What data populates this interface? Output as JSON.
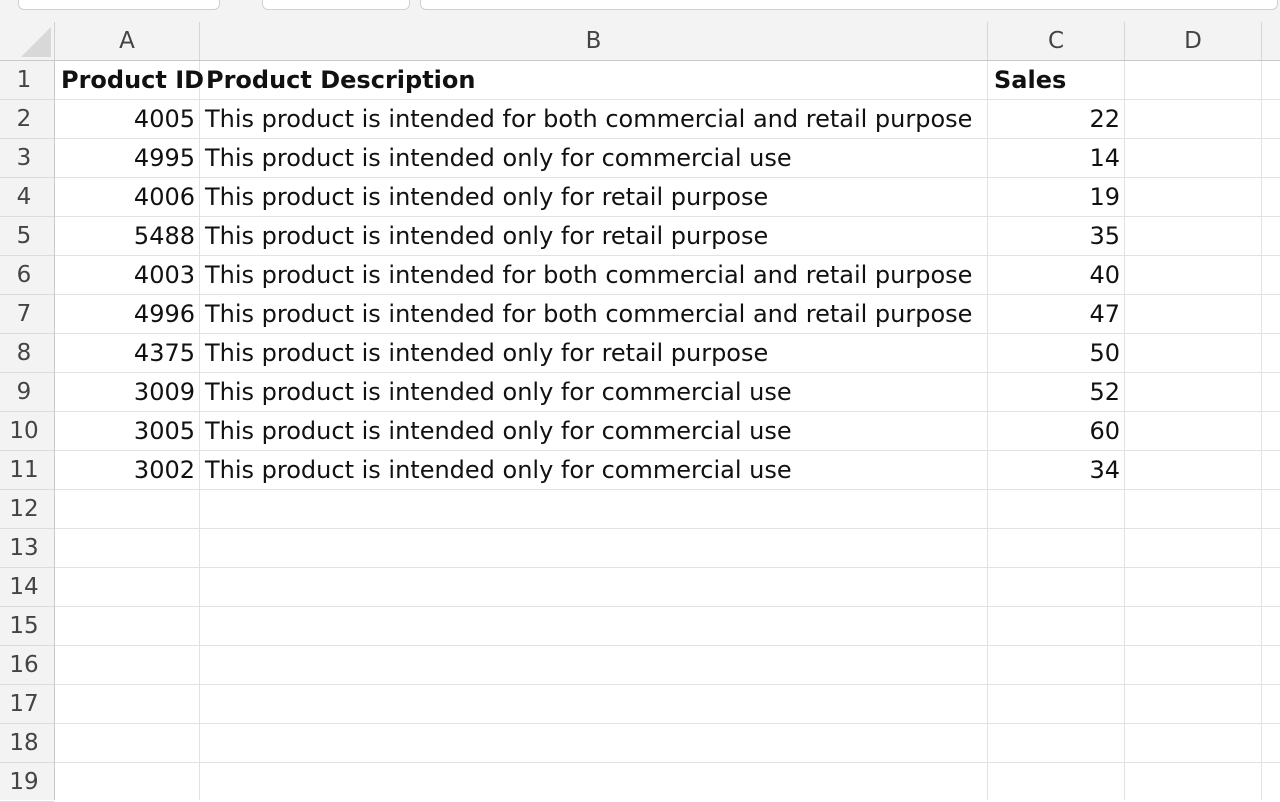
{
  "columns": [
    "A",
    "B",
    "C",
    "D"
  ],
  "rows": [
    "1",
    "2",
    "3",
    "4",
    "5",
    "6",
    "7",
    "8",
    "9",
    "10",
    "11",
    "12",
    "13",
    "14",
    "15",
    "16",
    "17",
    "18",
    "19"
  ],
  "header": {
    "product_id": "Product ID",
    "product_description": "Product Description",
    "sales": "Sales"
  },
  "data": [
    {
      "id": "4005",
      "desc": "This product is intended for both commercial and retail purpose",
      "sales": "22"
    },
    {
      "id": "4995",
      "desc": "This product is intended only for commercial use",
      "sales": "14"
    },
    {
      "id": "4006",
      "desc": "This product is intended only for retail purpose",
      "sales": "19"
    },
    {
      "id": "5488",
      "desc": "This product is intended only for retail purpose",
      "sales": "35"
    },
    {
      "id": "4003",
      "desc": "This product is intended for both commercial and retail purpose",
      "sales": "40"
    },
    {
      "id": "4996",
      "desc": "This product is intended for both commercial and retail purpose",
      "sales": "47"
    },
    {
      "id": "4375",
      "desc": "This product is intended only for retail purpose",
      "sales": "50"
    },
    {
      "id": "3009",
      "desc": "This product is intended only for commercial use",
      "sales": "52"
    },
    {
      "id": "3005",
      "desc": "This product is intended only for commercial use",
      "sales": "60"
    },
    {
      "id": "3002",
      "desc": "This product is intended only for commercial use",
      "sales": "34"
    }
  ],
  "colors": {
    "header_bg": "#f3f3f3",
    "gridline": "#e2e2e2",
    "text": "#111111"
  }
}
